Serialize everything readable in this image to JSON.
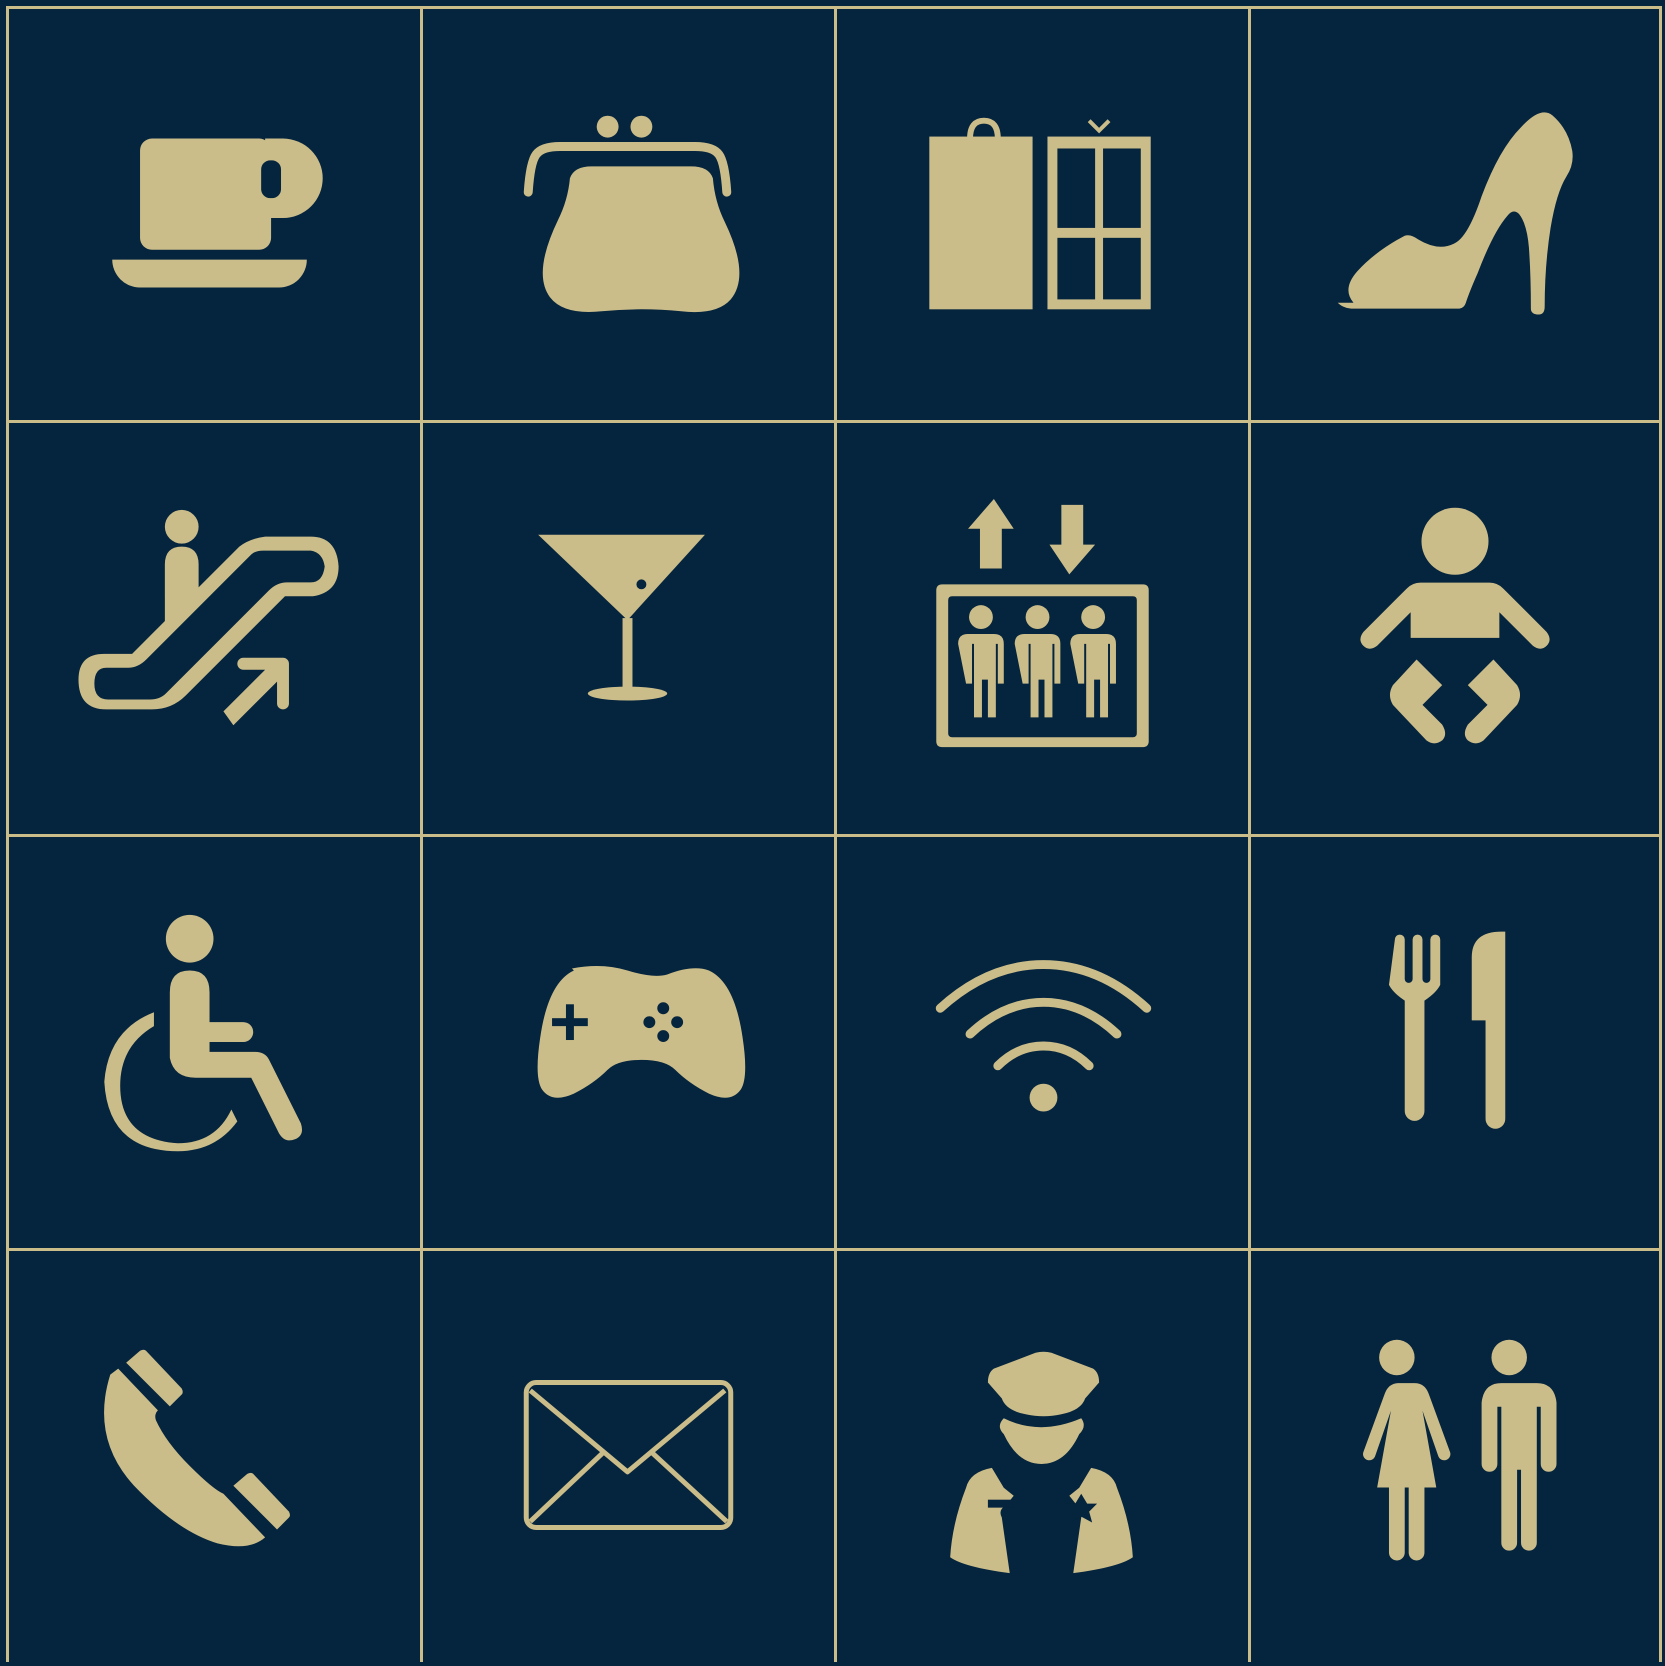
{
  "colors": {
    "background": "#05243d",
    "icon": "#cbbd8a",
    "grid_line": "#cbbd8a"
  },
  "icons": [
    "coffee-cup-icon",
    "purse-icon",
    "shopping-bag-gift-icon",
    "high-heel-icon",
    "escalator-icon",
    "cocktail-icon",
    "elevator-icon",
    "baby-changing-icon",
    "wheelchair-icon",
    "game-controller-icon",
    "wifi-icon",
    "restaurant-icon",
    "telephone-icon",
    "mail-icon",
    "security-guard-icon",
    "restroom-icon"
  ]
}
